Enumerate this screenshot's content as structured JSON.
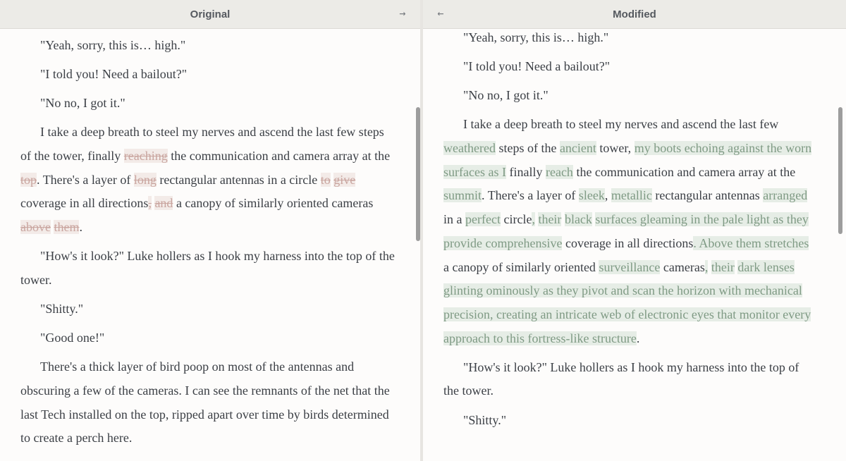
{
  "left": {
    "title": "Original",
    "sync_arrow": "→",
    "paragraphs": [
      [
        {
          "t": "\"Yeah, sorry, this is… high.\""
        }
      ],
      [
        {
          "t": "\"I told you! Need a bailout?\""
        }
      ],
      [
        {
          "t": "\"No no, I got it.\""
        }
      ],
      [
        {
          "t": "I take a deep breath to steel my nerves and ascend the last few steps of the tower, finally "
        },
        {
          "t": "reaching",
          "k": "del"
        },
        {
          "t": " the communication and camera array at the "
        },
        {
          "t": "top",
          "k": "del"
        },
        {
          "t": ". There's a layer of "
        },
        {
          "t": "long",
          "k": "del"
        },
        {
          "t": " rectangular antennas in a circle "
        },
        {
          "t": "to",
          "k": "del"
        },
        {
          "t": " "
        },
        {
          "t": "give",
          "k": "del"
        },
        {
          "t": " coverage in all directions"
        },
        {
          "t": ",",
          "k": "del"
        },
        {
          "t": " "
        },
        {
          "t": "and",
          "k": "del"
        },
        {
          "t": " a canopy of similarly oriented cameras "
        },
        {
          "t": "above",
          "k": "del"
        },
        {
          "t": " "
        },
        {
          "t": "them",
          "k": "del"
        },
        {
          "t": "."
        }
      ],
      [
        {
          "t": "\"How's it look?\" Luke hollers as I hook my harness into the top of the tower."
        }
      ],
      [
        {
          "t": "\"Shitty.\""
        }
      ],
      [
        {
          "t": "\"Good one!\""
        }
      ],
      [
        {
          "t": "There's a thick layer of bird poop on most of the antennas and obscuring a few of the cameras. I can see the remnants of the net that the last Tech installed on the top, ripped apart over time by birds determined to create a perch here."
        }
      ]
    ]
  },
  "right": {
    "title": "Modified",
    "sync_arrow": "←",
    "paragraphs": [
      [
        {
          "t": "\"Yeah, sorry, this is… high.\""
        }
      ],
      [
        {
          "t": "\"I told you! Need a bailout?\""
        }
      ],
      [
        {
          "t": "\"No no, I got it.\""
        }
      ],
      [
        {
          "t": "I take a deep breath to steel my nerves and ascend the last few "
        },
        {
          "t": "weathered",
          "k": "ins"
        },
        {
          "t": " steps of the "
        },
        {
          "t": "ancient",
          "k": "ins"
        },
        {
          "t": " tower, "
        },
        {
          "t": "my boots echoing against the worn surfaces as I",
          "k": "ins"
        },
        {
          "t": " finally "
        },
        {
          "t": "reach",
          "k": "ins"
        },
        {
          "t": " the communication and camera array at the "
        },
        {
          "t": "summit",
          "k": "ins"
        },
        {
          "t": ". There's a layer of "
        },
        {
          "t": "sleek",
          "k": "ins"
        },
        {
          "t": ", "
        },
        {
          "t": "metallic",
          "k": "ins"
        },
        {
          "t": " rectangular antennas "
        },
        {
          "t": "arranged",
          "k": "ins"
        },
        {
          "t": " in a "
        },
        {
          "t": "perfect",
          "k": "ins"
        },
        {
          "t": " circle"
        },
        {
          "t": ",",
          "k": "ins"
        },
        {
          "t": " "
        },
        {
          "t": "their",
          "k": "ins"
        },
        {
          "t": " "
        },
        {
          "t": "black",
          "k": "ins"
        },
        {
          "t": " "
        },
        {
          "t": "surfaces gleaming in the pale light as they provide comprehensive",
          "k": "ins"
        },
        {
          "t": " coverage in all directions"
        },
        {
          "t": ". Above them stretches",
          "k": "ins"
        },
        {
          "t": " a canopy of similarly oriented "
        },
        {
          "t": "surveillance",
          "k": "ins"
        },
        {
          "t": " cameras"
        },
        {
          "t": ",",
          "k": "ins"
        },
        {
          "t": " "
        },
        {
          "t": "their",
          "k": "ins"
        },
        {
          "t": " "
        },
        {
          "t": "dark lenses glinting ominously as they pivot and scan the horizon with mechanical precision, creating an intricate web of electronic eyes that monitor every approach to this fortress-like structure",
          "k": "ins"
        },
        {
          "t": "."
        }
      ],
      [
        {
          "t": "\"How's it look?\" Luke hollers as I hook my harness into the top of the tower."
        }
      ],
      [
        {
          "t": "\"Shitty.\""
        }
      ]
    ]
  },
  "colors": {
    "deleted_text": "#c9a59f",
    "inserted_text": "#7f9a84",
    "inserted_bg": "#e6ede6",
    "header_bg": "#ecebe7"
  }
}
